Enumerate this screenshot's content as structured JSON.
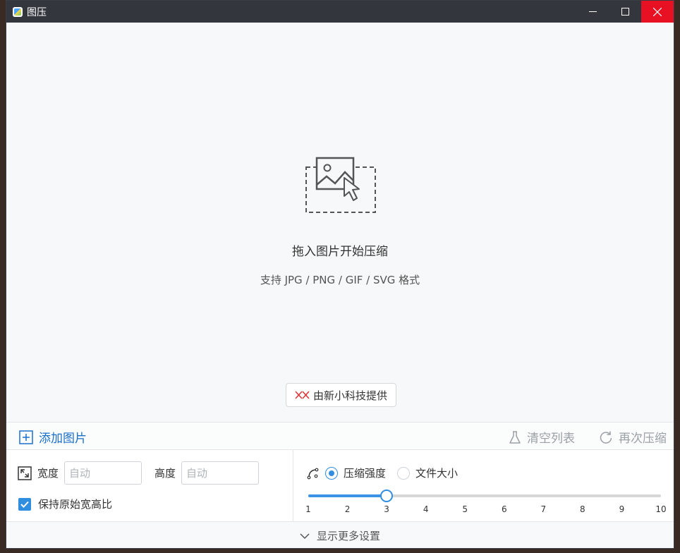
{
  "window": {
    "title": "图压"
  },
  "drop": {
    "title": "拖入图片开始压缩",
    "subtitle": "支持 JPG / PNG / GIF / SVG 格式",
    "provider": "由新小科技提供"
  },
  "actions": {
    "add": "添加图片",
    "clear": "清空列表",
    "recompress": "再次压缩"
  },
  "size": {
    "width_label": "宽度",
    "width_placeholder": "自动",
    "height_label": "高度",
    "height_placeholder": "自动",
    "keep_ratio_label": "保持原始宽高比",
    "keep_ratio_checked": true
  },
  "compress": {
    "mode_strength": "压缩强度",
    "mode_filesize": "文件大小",
    "selected_mode": "压缩强度",
    "level": 3,
    "min": 1,
    "max": 10,
    "ticks": [
      "1",
      "2",
      "3",
      "4",
      "5",
      "6",
      "7",
      "8",
      "9",
      "10"
    ]
  },
  "footer": {
    "more_settings": "显示更多设置"
  },
  "colors": {
    "accent": "#2f8ee0",
    "close": "#e81123",
    "titlebar": "#34363e"
  }
}
